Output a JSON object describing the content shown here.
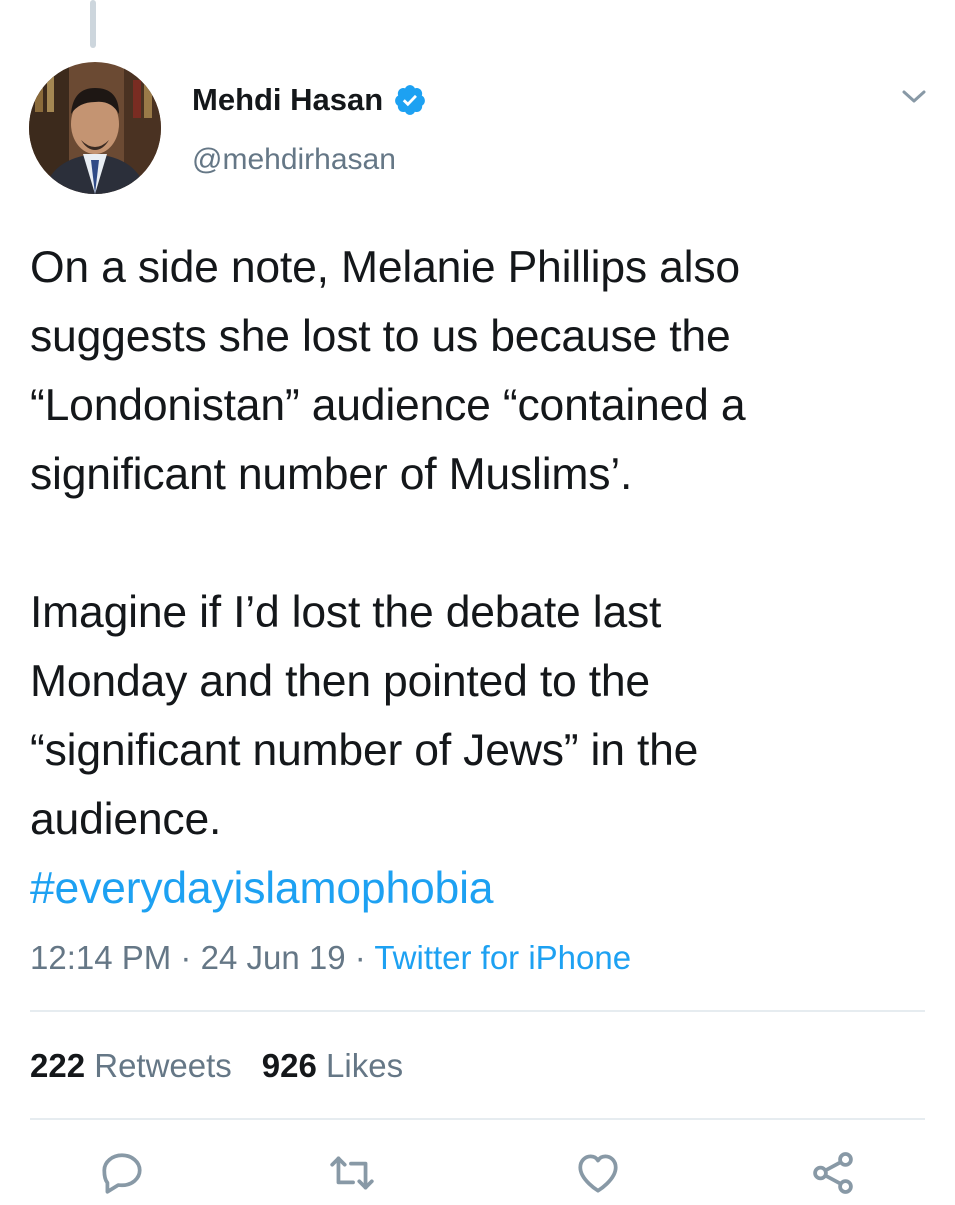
{
  "previous_tweet": {
    "snippet": ""
  },
  "author": {
    "name": "Mehdi Hasan",
    "handle": "@mehdirhasan",
    "verified": true
  },
  "tweet": {
    "paragraph1": "On a side note, Melanie Phillips also\nsuggests she lost to us because the\n“Londonistan” audience “contained a\nsignificant number of Muslims’.",
    "paragraph2": "Imagine if I’d lost the debate last\nMonday and then pointed to the\n“significant number of Jews” in the\naudience.",
    "hashtag": "#everydayislamophobia"
  },
  "meta": {
    "time": "12:14 PM",
    "date": "24 Jun 19",
    "separator": "·",
    "source": "Twitter for iPhone"
  },
  "stats": {
    "retweets_count": "222",
    "retweets_label": "Retweets",
    "likes_count": "926",
    "likes_label": "Likes"
  },
  "icons": {
    "verified": "verified-badge-icon",
    "caret": "chevron-down-icon",
    "reply": "reply-icon",
    "retweet": "retweet-icon",
    "like": "heart-icon",
    "share": "share-icon"
  },
  "colors": {
    "accent": "#1da1f2",
    "secondary_text": "#657786",
    "primary_text": "#14171a",
    "divider": "#e6ecf0"
  }
}
